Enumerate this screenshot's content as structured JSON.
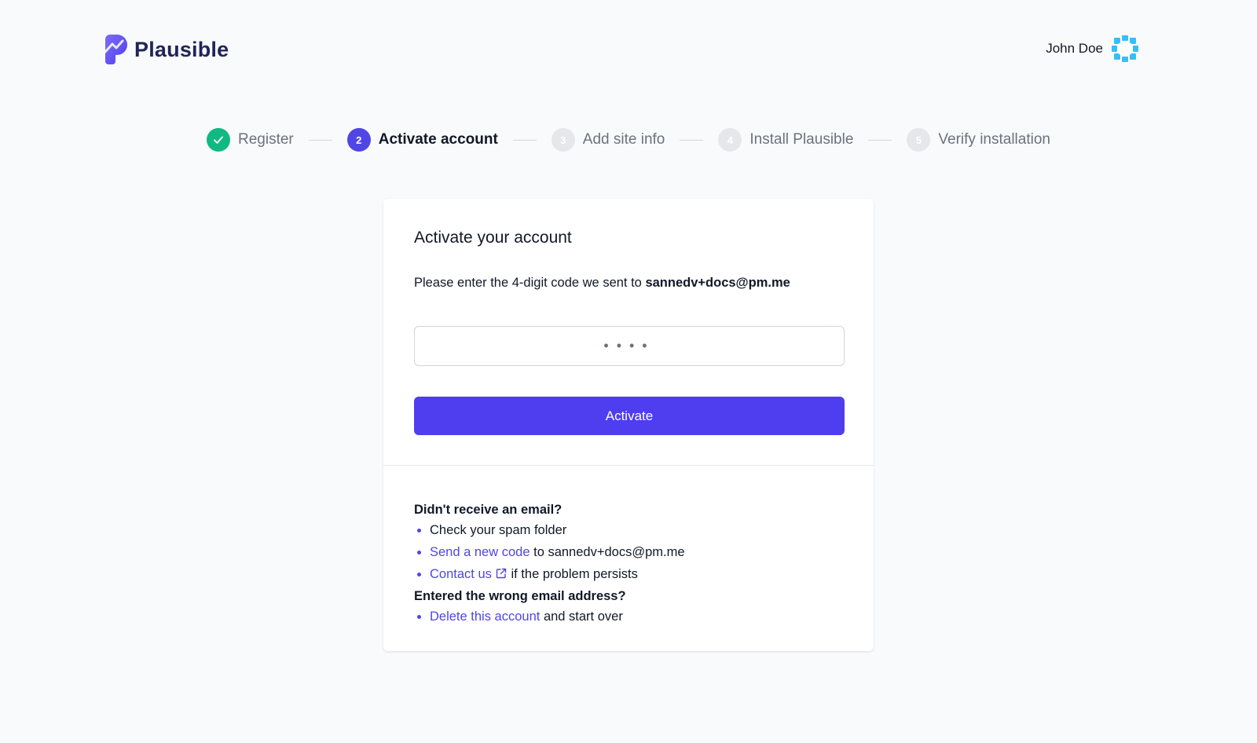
{
  "header": {
    "logo_text": "Plausible",
    "user_name": "John Doe",
    "brand_color": "#4f46e5"
  },
  "stepper": {
    "steps": [
      {
        "number": "",
        "label": "Register",
        "state": "done"
      },
      {
        "number": "2",
        "label": "Activate account",
        "state": "active"
      },
      {
        "number": "3",
        "label": "Add site info",
        "state": "todo"
      },
      {
        "number": "4",
        "label": "Install Plausible",
        "state": "todo"
      },
      {
        "number": "5",
        "label": "Verify installation",
        "state": "todo"
      }
    ],
    "done_color": "#10b981",
    "active_color": "#4f46e5"
  },
  "card": {
    "title": "Activate your account",
    "desc_prefix": "Please enter the 4-digit code we sent to",
    "email": "sannedv+docs@pm.me",
    "code_placeholder": "••••",
    "activate_label": "Activate"
  },
  "help": {
    "no_email_heading": "Didn't receive an email?",
    "spam_text": "Check your spam folder",
    "send_new_code_link": "Send a new code",
    "send_new_code_suffix": "to sannedv+docs@pm.me",
    "contact_link": "Contact us",
    "contact_suffix": "if the problem persists",
    "wrong_email_heading": "Entered the wrong email address?",
    "delete_link": "Delete this account",
    "delete_suffix": "and start over"
  }
}
